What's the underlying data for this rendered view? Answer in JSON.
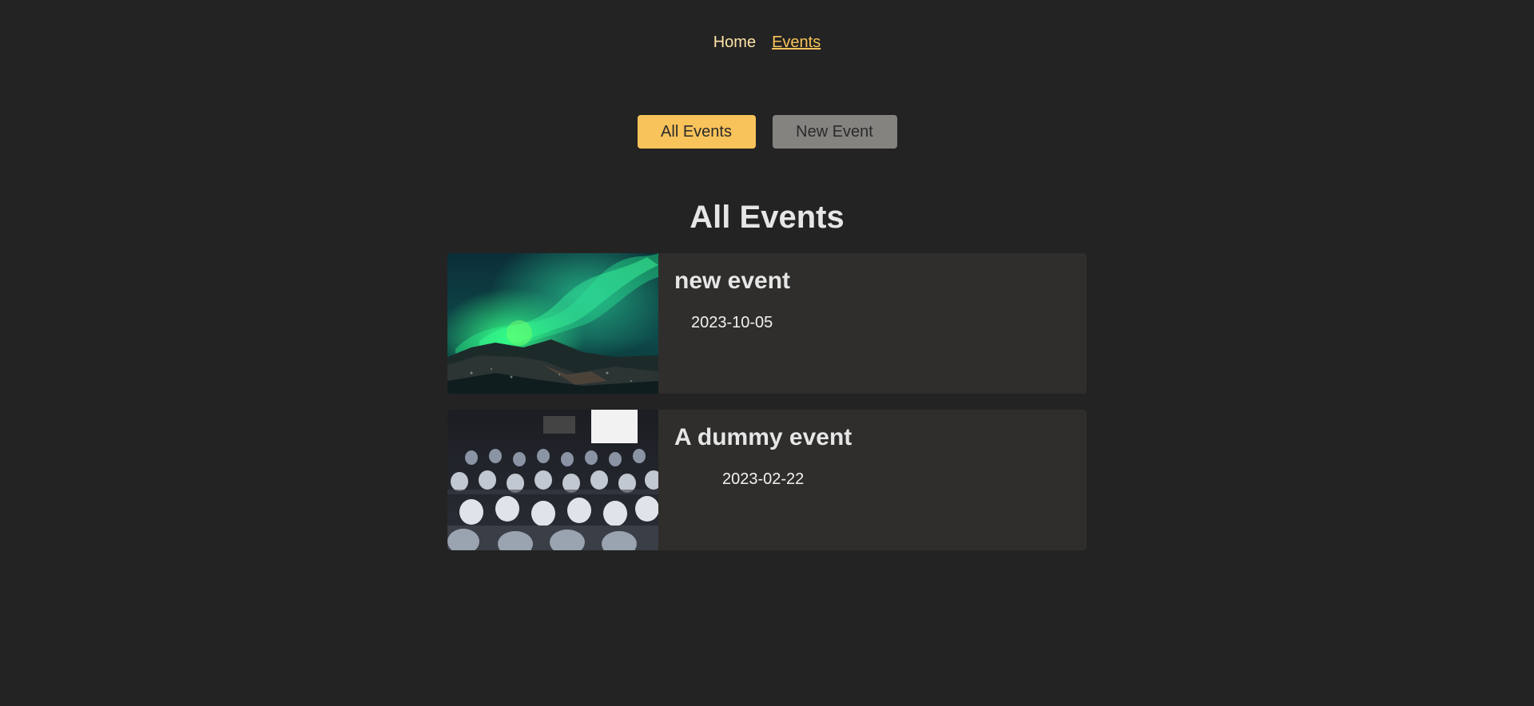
{
  "nav": {
    "home_label": "Home",
    "events_label": "Events"
  },
  "actions": {
    "all_events_label": "All Events",
    "new_event_label": "New Event"
  },
  "page": {
    "title": "All Events"
  },
  "events": [
    {
      "title": "new event",
      "date": "2023-10-05"
    },
    {
      "title": "A dummy event",
      "date": "2023-02-22"
    }
  ],
  "colors": {
    "background": "#232323",
    "accent": "#f8c35a",
    "card": "#2f2e2c",
    "secondary_button": "#858380"
  }
}
